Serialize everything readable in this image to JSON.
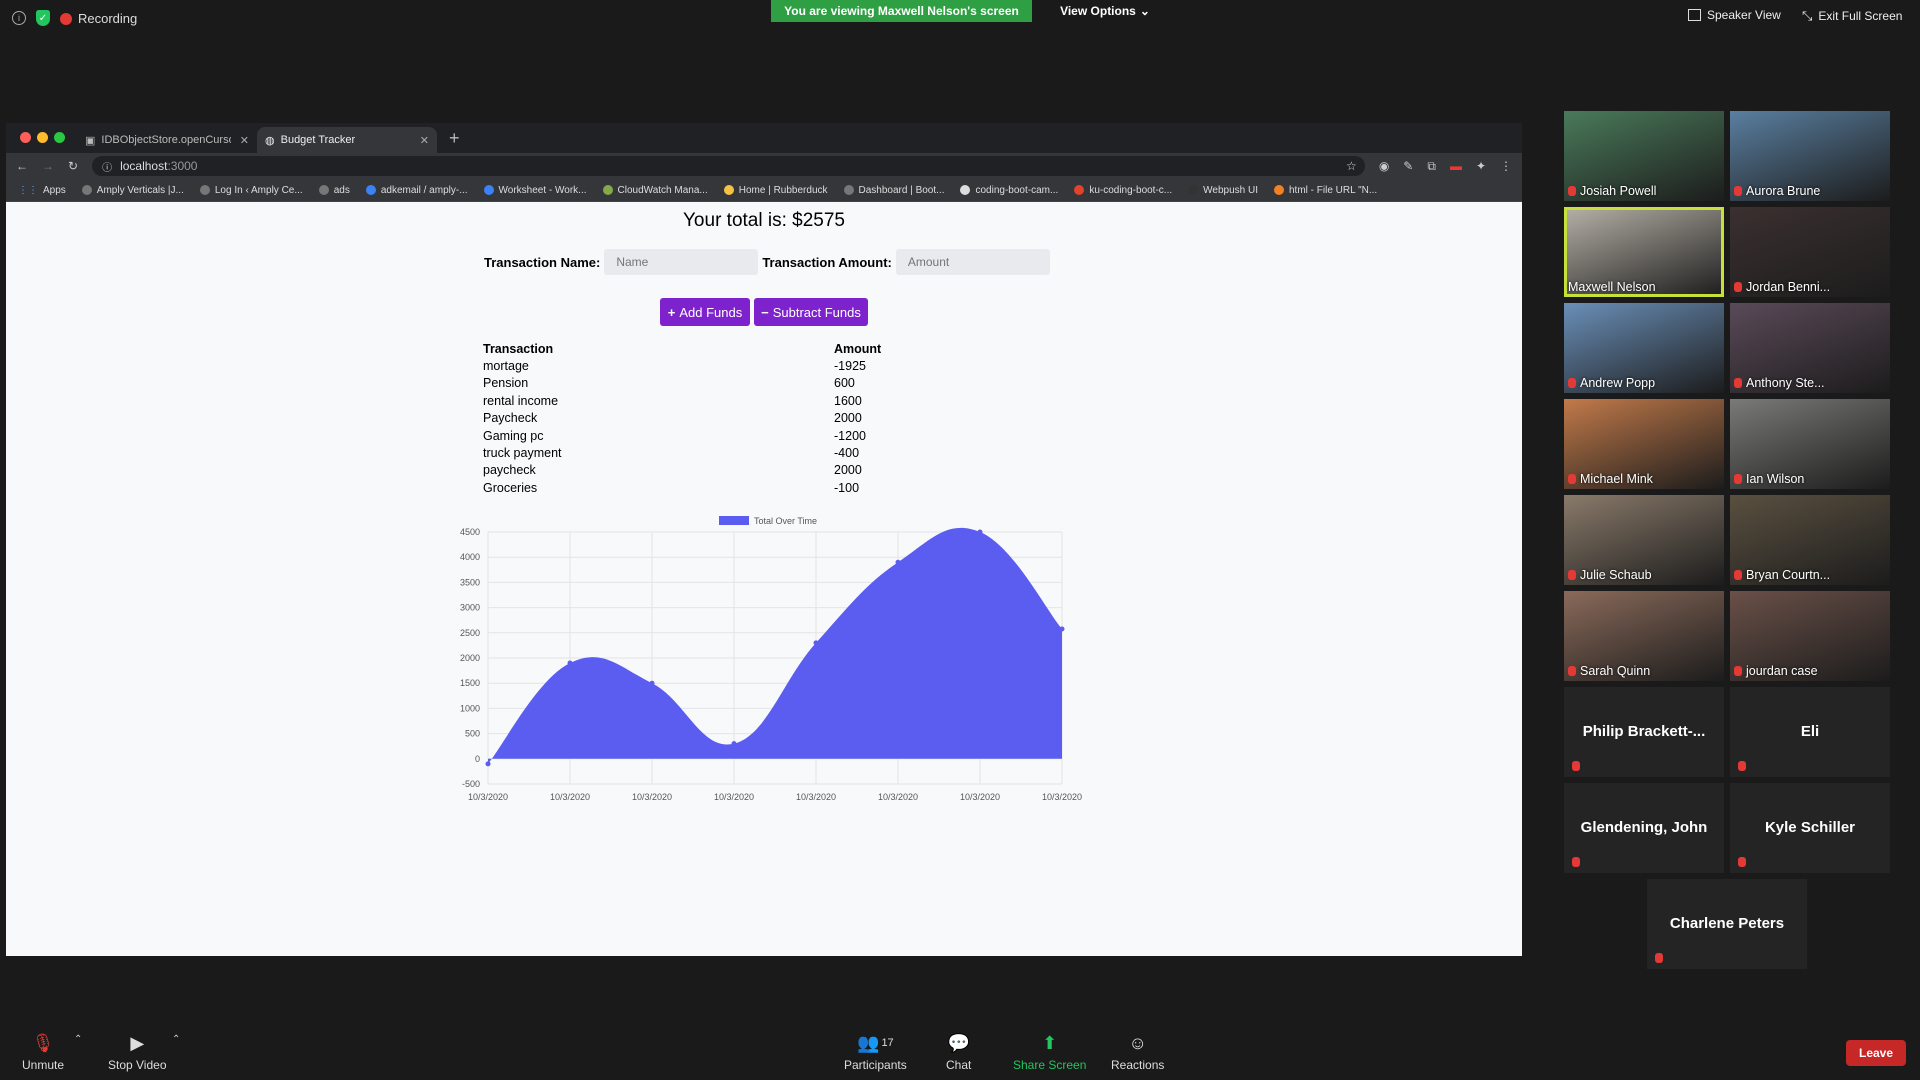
{
  "zoom": {
    "recording": "Recording",
    "viewing_banner": "You are viewing Maxwell Nelson's screen",
    "view_options": "View Options",
    "speaker_view": "Speaker View",
    "exit_full_screen": "Exit Full Screen",
    "bottom": {
      "unmute": "Unmute",
      "stop_video": "Stop Video",
      "participants": "Participants",
      "participant_count": "17",
      "chat": "Chat",
      "share_screen": "Share Screen",
      "reactions": "Reactions",
      "leave": "Leave"
    },
    "participants": [
      {
        "name": "Josiah Powell",
        "bg": "#4a7a5a"
      },
      {
        "name": "Aurora Brune",
        "bg": "#5a7fa0"
      },
      {
        "name": "Maxwell Nelson",
        "bg": "#b7b2a8"
      },
      {
        "name": "Jordan Benni...",
        "bg": "#3b3030"
      },
      {
        "name": "Andrew Popp",
        "bg": "#6a8fb8"
      },
      {
        "name": "Anthony Ste...",
        "bg": "#5a4a58"
      },
      {
        "name": "Michael Mink",
        "bg": "#c27a4a"
      },
      {
        "name": "Ian Wilson",
        "bg": "#7a7a78"
      },
      {
        "name": "Julie Schaub",
        "bg": "#8a7a6a"
      },
      {
        "name": "Bryan Courtn...",
        "bg": "#5a5040"
      },
      {
        "name": "Sarah Quinn",
        "bg": "#8a6a5a"
      },
      {
        "name": "jourdan case",
        "bg": "#6a5048"
      }
    ],
    "audio_only": [
      "Philip  Brackett-...",
      "Eli",
      "Glendening, John",
      "Kyle Schiller",
      "Charlene Peters"
    ]
  },
  "browser": {
    "tabs": [
      "IDBObjectStore.openCursor()",
      "Budget Tracker"
    ],
    "url_host": "localhost",
    "url_port": ":3000",
    "bookmarks": [
      "Apps",
      "Amply Verticals |J...",
      "Log In ‹ Amply Ce...",
      "ads",
      "adkemail / amply-...",
      "Worksheet - Work...",
      "CloudWatch Mana...",
      "Home | Rubberduck",
      "Dashboard | Boot...",
      "coding-boot-cam...",
      "ku-coding-boot-c...",
      "Webpush UI",
      "html - File URL \"N..."
    ]
  },
  "app": {
    "total": "Your total is: $2575",
    "name_label": "Transaction Name:",
    "name_placeholder": "Name",
    "amount_label": "Transaction Amount:",
    "amount_placeholder": "Amount",
    "add_button": "Add Funds",
    "subtract_button": "Subtract Funds",
    "table_headers": [
      "Transaction",
      "Amount"
    ],
    "transactions": [
      {
        "name": "mortage",
        "amount": "-1925"
      },
      {
        "name": "Pension",
        "amount": "600"
      },
      {
        "name": "rental income",
        "amount": "1600"
      },
      {
        "name": "Paycheck",
        "amount": "2000"
      },
      {
        "name": "Gaming pc",
        "amount": "-1200"
      },
      {
        "name": "truck payment",
        "amount": "-400"
      },
      {
        "name": "paycheck",
        "amount": "2000"
      },
      {
        "name": "Groceries",
        "amount": "-100"
      }
    ]
  },
  "chart_data": {
    "type": "area",
    "legend": "Total Over Time",
    "color": "#5b5cf0",
    "x": [
      "10/3/2020",
      "10/3/2020",
      "10/3/2020",
      "10/3/2020",
      "10/3/2020",
      "10/3/2020",
      "10/3/2020",
      "10/3/2020"
    ],
    "values": [
      -100,
      1900,
      1500,
      300,
      2300,
      3900,
      4500,
      2575
    ],
    "ylim": [
      -500,
      4500
    ],
    "yticks": [
      4500,
      4000,
      3500,
      3000,
      2500,
      2000,
      1500,
      1000,
      500,
      0,
      -500
    ]
  }
}
